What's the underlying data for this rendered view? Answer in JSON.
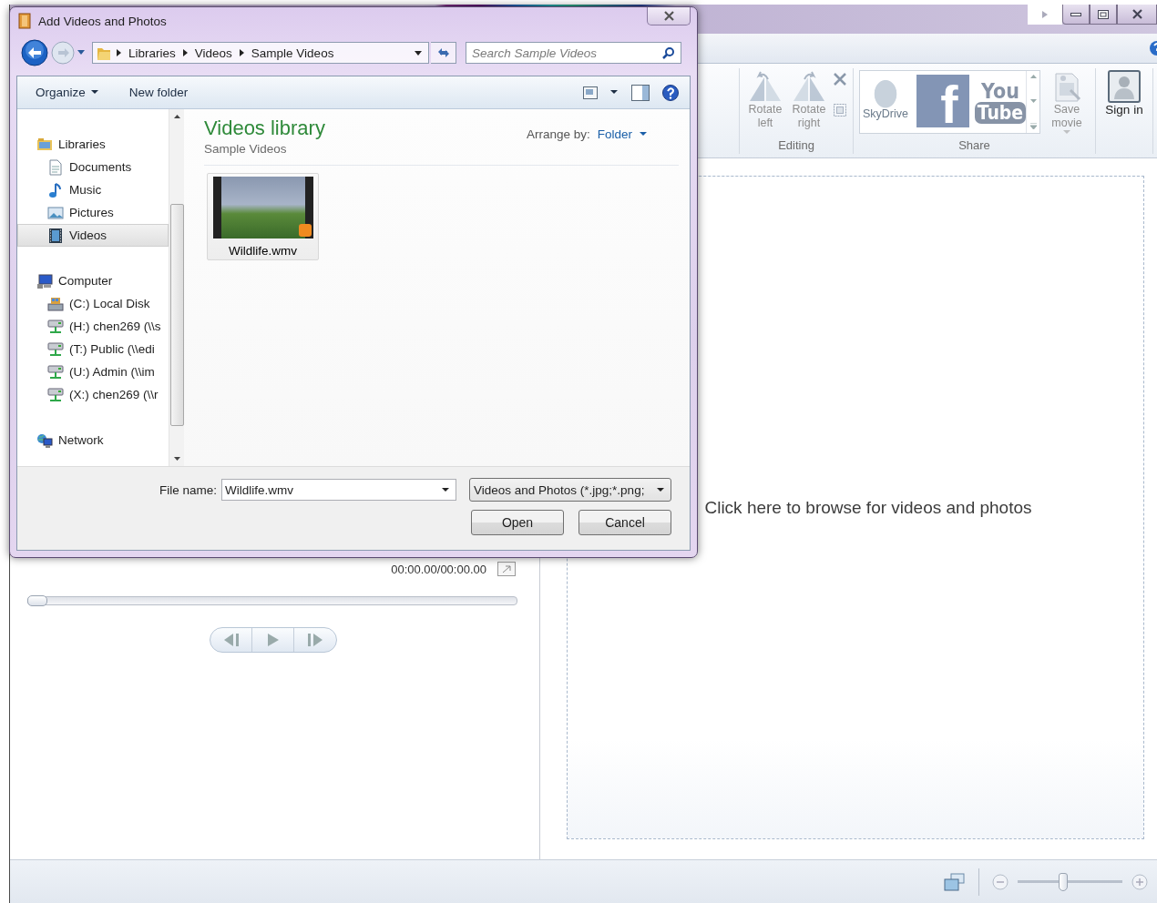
{
  "app": {
    "ribbon": {
      "editing": {
        "label": "Editing",
        "buttons": [
          {
            "label": "Rotate left",
            "disabled": true
          },
          {
            "label": "Rotate right",
            "disabled": true
          }
        ]
      },
      "share": {
        "label": "Share",
        "gallery": [
          {
            "kind": "skydrive",
            "label": "SkyDrive"
          },
          {
            "kind": "facebook",
            "label": "f"
          },
          {
            "kind": "youtube",
            "label": "You",
            "label_2": "Tube"
          }
        ],
        "save_movie": {
          "label": "Save movie",
          "disabled": true
        }
      },
      "sign_in": {
        "label": "Sign in",
        "disabled": false
      }
    },
    "preview": {
      "time": "00:00.00/00:00.00",
      "seek_slider": {
        "level": 0
      }
    },
    "storyboard": {
      "browse_hint": "Click here to browse for videos and photos"
    },
    "status_bar": {
      "zoom_slider": {
        "level": 0.43
      }
    }
  },
  "dialog": {
    "title": "Add Videos and Photos",
    "breadcrumb": [
      "Libraries",
      "Videos",
      "Sample Videos"
    ],
    "search": {
      "placeholder": "Search Sample Videos"
    },
    "toolbar": [
      {
        "kind": "menu",
        "label": "Organize"
      },
      {
        "kind": "button",
        "label": "New folder"
      }
    ],
    "nav": [
      {
        "label": "Libraries",
        "selected": false,
        "children": [
          {
            "label": "Documents",
            "selected": false
          },
          {
            "label": "Music",
            "selected": false
          },
          {
            "label": "Pictures",
            "selected": false
          },
          {
            "label": "Videos",
            "selected": true
          }
        ]
      },
      {
        "label": "Computer",
        "selected": false,
        "children": [
          {
            "label": "(C:) Local Disk",
            "selected": false
          },
          {
            "label": "(H:) chen269 (\\\\s",
            "selected": false
          },
          {
            "label": "(T:) Public (\\\\edi",
            "selected": false
          },
          {
            "label": "(U:) Admin (\\\\im",
            "selected": false
          },
          {
            "label": "(X:) chen269 (\\\\r",
            "selected": false
          }
        ]
      },
      {
        "label": "Network",
        "selected": false
      }
    ],
    "library": {
      "title": "Videos library",
      "subtitle": "Sample Videos",
      "arrange_label": "Arrange by:",
      "arrange_value": "Folder"
    },
    "files": [
      {
        "name": "Wildlife.wmv"
      }
    ],
    "file_name": {
      "label": "File name:",
      "value": "Wildlife.wmv"
    },
    "file_type": "Videos and Photos (*.jpg;*.png;",
    "buttons": [
      "Open",
      "Cancel"
    ]
  }
}
